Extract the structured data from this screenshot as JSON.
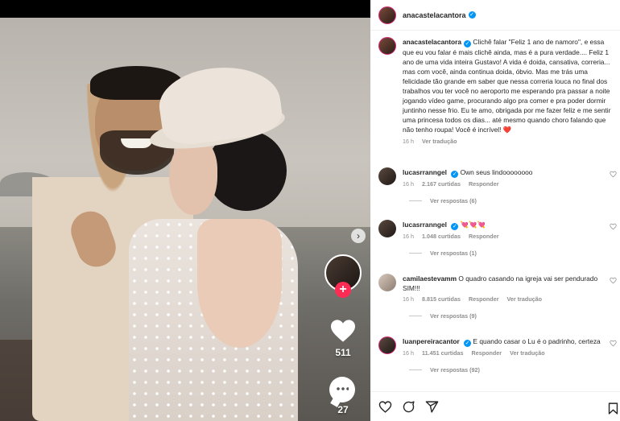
{
  "post": {
    "author": "anacastelacantora",
    "caption_author": "anacastelacantora",
    "caption": "Clichê falar \"Feliz 1 ano de namoro\", e essa que eu vou falar é mais clichê ainda, mas é a pura verdade.... Feliz 1 ano de uma vida inteira Gustavo! A vida é doida, cansativa, correria... mas com você, ainda continua doida, óbvio. Mas me trás uma felicidade tão grande em saber que nessa correria louca no final dos trabalhos vou ter você no aeroporto me esperando pra passar a noite jogando vídeo game, procurando algo pra comer e pra poder dormir juntinho nesse frio. Eu te amo, obrigada por me fazer feliz e me sentir uma princesa todos os dias... até mesmo quando choro falando que não tenho roupa! Você é incrível! ❤️",
    "caption_time": "16 h",
    "see_translation": "Ver tradução"
  },
  "media": {
    "like_count": "511",
    "comment_count": "27",
    "next_glyph": "›",
    "follow_glyph": "+"
  },
  "comments": [
    {
      "user": "lucasrranngel",
      "verified": true,
      "text": "Own seus lindoooooooo",
      "time": "16 h",
      "likes": "2.167 curtidas",
      "reply": "Responder",
      "translate": "",
      "view_replies": "Ver respostas (6)"
    },
    {
      "user": "lucasrranngel",
      "verified": true,
      "text": "💘💘💘",
      "time": "16 h",
      "likes": "1.048 curtidas",
      "reply": "Responder",
      "translate": "",
      "view_replies": "Ver respostas (1)"
    },
    {
      "user": "camilaestevamm",
      "verified": false,
      "text": "O quadro casando na igreja vai ser pendurado SIM!!!",
      "time": "16 h",
      "likes": "8.815 curtidas",
      "reply": "Responder",
      "translate": "Ver tradução",
      "view_replies": "Ver respostas (9)"
    },
    {
      "user": "luanpereiracantor",
      "verified": true,
      "text": "E quando casar o Lu é o padrinho, certeza",
      "time": "16 h",
      "likes": "11.451 curtidas",
      "reply": "Responder",
      "translate": "Ver tradução",
      "view_replies": "Ver respostas (92)"
    }
  ],
  "icons": {
    "verified": "verified-badge-icon",
    "heart": "heart-icon",
    "comment": "comment-icon",
    "share": "share-icon",
    "save": "bookmark-icon"
  },
  "colors": {
    "verified": "#0095f6",
    "follow_button": "#fe2c55",
    "story_ring": "#d62976",
    "heart_red": "#ed4956"
  }
}
